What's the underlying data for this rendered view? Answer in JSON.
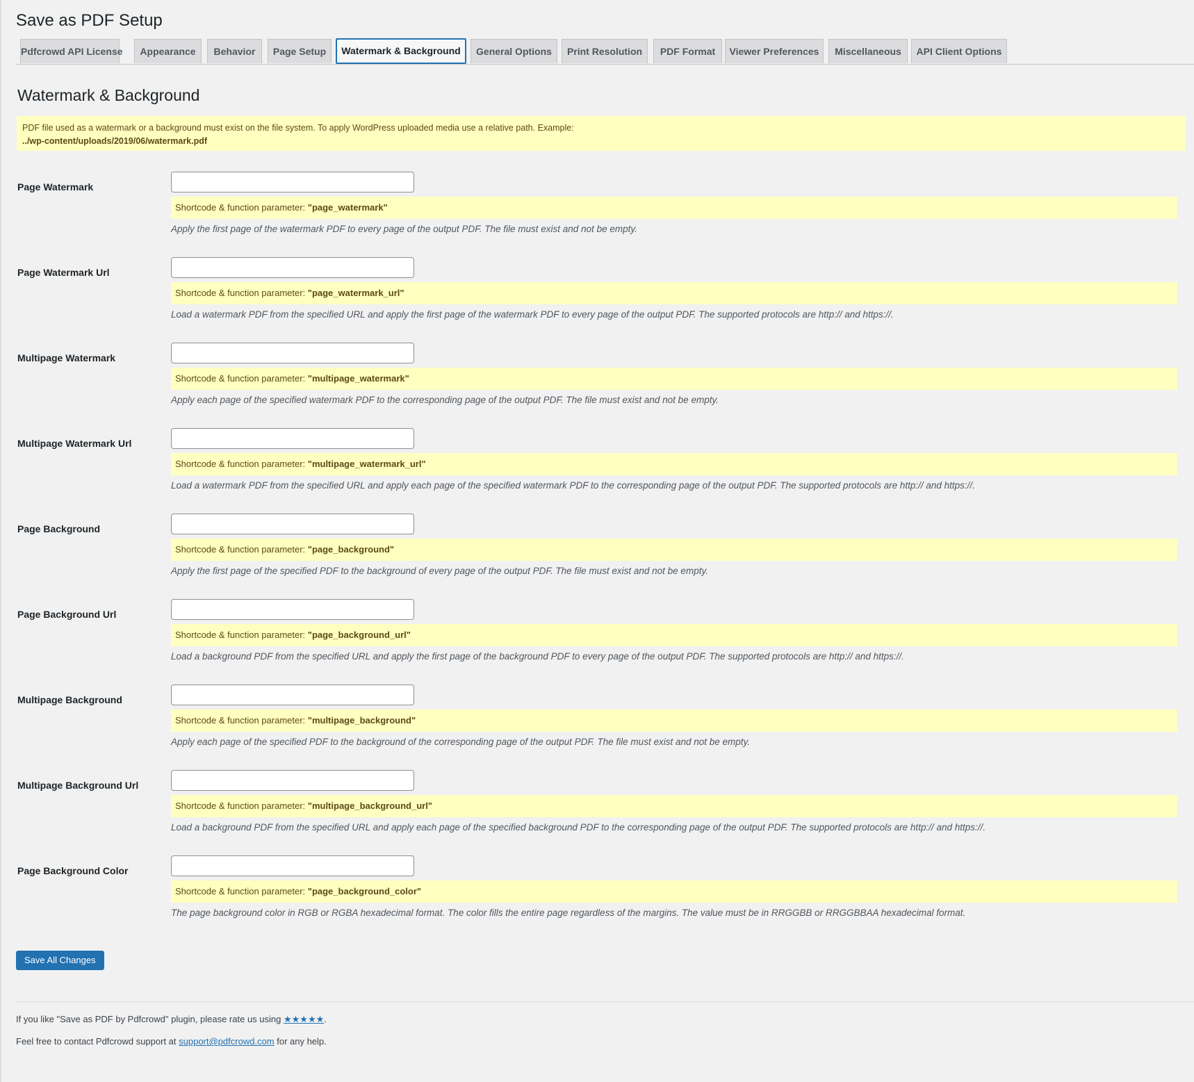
{
  "page": {
    "title": "Save as PDF Setup"
  },
  "tabs": [
    {
      "label": "Pdfcrowd API License"
    },
    {
      "label": "Appearance"
    },
    {
      "label": "Behavior"
    },
    {
      "label": "Page Setup"
    },
    {
      "label": "Watermark & Background",
      "active": true
    },
    {
      "label": "General Options"
    },
    {
      "label": "Print Resolution"
    },
    {
      "label": "PDF Format"
    },
    {
      "label": "Viewer Preferences"
    },
    {
      "label": "Miscellaneous"
    },
    {
      "label": "API Client Options"
    }
  ],
  "section": {
    "title": "Watermark & Background",
    "notice_text": "PDF file used as a watermark or a background must exist on the file system. To apply WordPress uploaded media use a relative path. Example:",
    "notice_path": "../wp-content/uploads/2019/06/watermark.pdf"
  },
  "shortcode_prefix": "Shortcode & function parameter: ",
  "fields": [
    {
      "label": "Page Watermark",
      "value": "",
      "param": "\"page_watermark\"",
      "description": "Apply the first page of the watermark PDF to every page of the output PDF. The file must exist and not be empty."
    },
    {
      "label": "Page Watermark Url",
      "value": "",
      "param": "\"page_watermark_url\"",
      "description": "Load a watermark PDF from the specified URL and apply the first page of the watermark PDF to every page of the output PDF. The supported protocols are http:// and https://."
    },
    {
      "label": "Multipage Watermark",
      "value": "",
      "param": "\"multipage_watermark\"",
      "description": "Apply each page of the specified watermark PDF to the corresponding page of the output PDF. The file must exist and not be empty."
    },
    {
      "label": "Multipage Watermark Url",
      "value": "",
      "param": "\"multipage_watermark_url\"",
      "description": "Load a watermark PDF from the specified URL and apply each page of the specified watermark PDF to the corresponding page of the output PDF. The supported protocols are http:// and https://."
    },
    {
      "label": "Page Background",
      "value": "",
      "param": "\"page_background\"",
      "description": "Apply the first page of the specified PDF to the background of every page of the output PDF. The file must exist and not be empty."
    },
    {
      "label": "Page Background Url",
      "value": "",
      "param": "\"page_background_url\"",
      "description": "Load a background PDF from the specified URL and apply the first page of the background PDF to every page of the output PDF. The supported protocols are http:// and https://."
    },
    {
      "label": "Multipage Background",
      "value": "",
      "param": "\"multipage_background\"",
      "description": "Apply each page of the specified PDF to the background of the corresponding page of the output PDF. The file must exist and not be empty."
    },
    {
      "label": "Multipage Background Url",
      "value": "",
      "param": "\"multipage_background_url\"",
      "description": "Load a background PDF from the specified URL and apply each page of the specified background PDF to the corresponding page of the output PDF. The supported protocols are http:// and https://."
    },
    {
      "label": "Page Background Color",
      "value": "",
      "param": "\"page_background_color\"",
      "description": "The page background color in RGB or RGBA hexadecimal format. The color fills the entire page regardless of the margins. The value must be in RRGGBB or RRGGBBAA hexadecimal format."
    }
  ],
  "actions": {
    "save_label": "Save All Changes"
  },
  "footer": {
    "rate_prefix": "If you like \"Save as PDF by Pdfcrowd\" plugin, please rate us using ",
    "rate_stars": "★★★★★",
    "rate_suffix": ".",
    "contact_prefix": "Feel free to contact Pdfcrowd support at ",
    "contact_email": "support@pdfcrowd.com",
    "contact_suffix": " for any help."
  },
  "colors": {
    "accent": "#2271b1",
    "notice_bg": "#ffffc0",
    "page_bg": "#f1f1f1"
  }
}
